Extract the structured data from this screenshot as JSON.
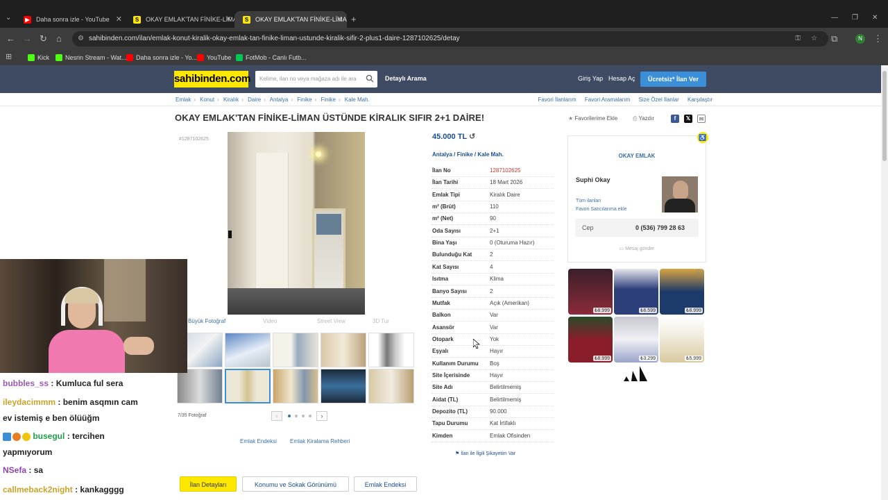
{
  "tabs": [
    {
      "label": "Daha sonra izle - YouTube",
      "icon": "youtube-icon"
    },
    {
      "label": "OKAY EMLAK'TAN FİNİKE-LİMA",
      "icon": "sahibinden-icon"
    },
    {
      "label": "OKAY EMLAK'TAN FİNİKE-LİMA",
      "icon": "sahibinden-icon"
    }
  ],
  "url": "sahibinden.com/ilan/emlak-konut-kiralik-okay-emlak-tan-finike-liman-ustunde-kiralik-sifir-2-plus1-daire-1287102625/detay",
  "bookmarks": [
    {
      "label": "Kick",
      "color": "#53fc18"
    },
    {
      "label": "Nesrin Stream - Wat...",
      "color": "#53fc18"
    },
    {
      "label": "Daha sonra izle - Yo...",
      "color": "#ff0000"
    },
    {
      "label": "YouTube",
      "color": "#ff0000"
    },
    {
      "label": "FotMob - Canlı Futb...",
      "color": "#00c853"
    }
  ],
  "profile_initial": "N",
  "header": {
    "logo": "sahibinden.com",
    "search_placeholder": "Kelime, ilan no veya mağaza adı ile ara",
    "detailed_search": "Detaylı Arama",
    "login": "Giriş Yap",
    "register": "Hesap Aç",
    "post_ad": "Ücretsiz* İlan Ver"
  },
  "breadcrumb": [
    "Emlak",
    "Konut",
    "Kiralık",
    "Daire",
    "Antalya",
    "Finike",
    "Finike",
    "Kale Mah."
  ],
  "top_links": [
    "Favori İlanlarım",
    "Favori Aramalarım",
    "Size Özel İlanlar",
    "Karşılaştır"
  ],
  "title": "OKAY EMLAK'TAN FİNİKE-LİMAN ÜSTÜNDE KİRALIK SIFIR 2+1 DAİRE!",
  "actions": {
    "favorite": "Favorilerime Ekle",
    "print": "Yazdır"
  },
  "listing_number_small": "#1287102625",
  "photo_tabs": [
    "Büyük Fotoğraf",
    "Video",
    "Street View",
    "3D Tur"
  ],
  "photo_count": "7/35 Fotoğraf",
  "price": "45.000 TL",
  "location": [
    "Antalya",
    "Finike",
    "Kale Mah."
  ],
  "details": [
    {
      "label": "İlan No",
      "value": "1287102625"
    },
    {
      "label": "İlan Tarihi",
      "value": "18 Mart 2026"
    },
    {
      "label": "Emlak Tipi",
      "value": "Kiralık Daire"
    },
    {
      "label": "m² (Brüt)",
      "value": "110"
    },
    {
      "label": "m² (Net)",
      "value": "90"
    },
    {
      "label": "Oda Sayısı",
      "value": "2+1"
    },
    {
      "label": "Bina Yaşı",
      "value": "0 (Oturuma Hazır)"
    },
    {
      "label": "Bulunduğu Kat",
      "value": "2"
    },
    {
      "label": "Kat Sayısı",
      "value": "4"
    },
    {
      "label": "Isıtma",
      "value": "Klima"
    },
    {
      "label": "Banyo Sayısı",
      "value": "2"
    },
    {
      "label": "Mutfak",
      "value": "Açık (Amerikan)"
    },
    {
      "label": "Balkon",
      "value": "Var"
    },
    {
      "label": "Asansör",
      "value": "Var"
    },
    {
      "label": "Otopark",
      "value": "Yok"
    },
    {
      "label": "Eşyalı",
      "value": "Hayır"
    },
    {
      "label": "Kullanım Durumu",
      "value": "Boş"
    },
    {
      "label": "Site İçerisinde",
      "value": "Hayır"
    },
    {
      "label": "Site Adı",
      "value": "Belirtilmemiş"
    },
    {
      "label": "Aidat (TL)",
      "value": "Belirtilmemiş"
    },
    {
      "label": "Depozito (TL)",
      "value": "90.000"
    },
    {
      "label": "Tapu Durumu",
      "value": "Kat İrtifaklı"
    },
    {
      "label": "Kimden",
      "value": "Emlak Ofisinden"
    }
  ],
  "complaint": "İlan ile İlgili Şikayetim Var",
  "seller": {
    "firm": "OKAY EMLAK",
    "name": "Suphi Okay",
    "all_listings": "Tüm ilanları",
    "add_favorite": "Favori Satıcılarıma ekle",
    "phone_label": "Cep",
    "phone": "0 (536) 799 28 63",
    "message": "Mesaj gönder"
  },
  "ads": [
    {
      "price": "₺8.999",
      "color": "#7a2a3a"
    },
    {
      "price": "₺6.599",
      "color": "#2d3f7a"
    },
    {
      "price": "₺8.999",
      "color": "#1c3a6a"
    },
    {
      "price": "₺8.999",
      "color": "#8a1d2a"
    },
    {
      "price": "₺3.299",
      "color": "#e8e8f0"
    },
    {
      "price": "₺5.999",
      "color": "#f2ede0"
    }
  ],
  "bottom_links": [
    "Emlak Endeksi",
    "Emlak Kiralama Rehberi"
  ],
  "bottom_tabs": [
    "İlan Detayları",
    "Konumu ve Sokak Görünümü",
    "Emlak Endeksi"
  ],
  "chat": [
    {
      "user": "bubbles_ss",
      "msg": ": Kumluca ful sera",
      "color": "#9b59b6"
    },
    {
      "user": "ileydacimmm",
      "msg": ": benim asqmın cam",
      "color": "#c9a227"
    },
    {
      "user": "",
      "msg": "ev istemiş e ben ölüüğm",
      "color": "#222"
    },
    {
      "user": "busegul",
      "msg": ": tercihen",
      "color": "#1e9e4a"
    },
    {
      "user": "",
      "msg": "yapmıyorum",
      "color": "#222"
    },
    {
      "user": "NSefa",
      "msg": ": sa",
      "color": "#8e44ad"
    },
    {
      "user": "callmeback2night",
      "msg": ": kankagggg",
      "color": "#c9a227"
    }
  ]
}
